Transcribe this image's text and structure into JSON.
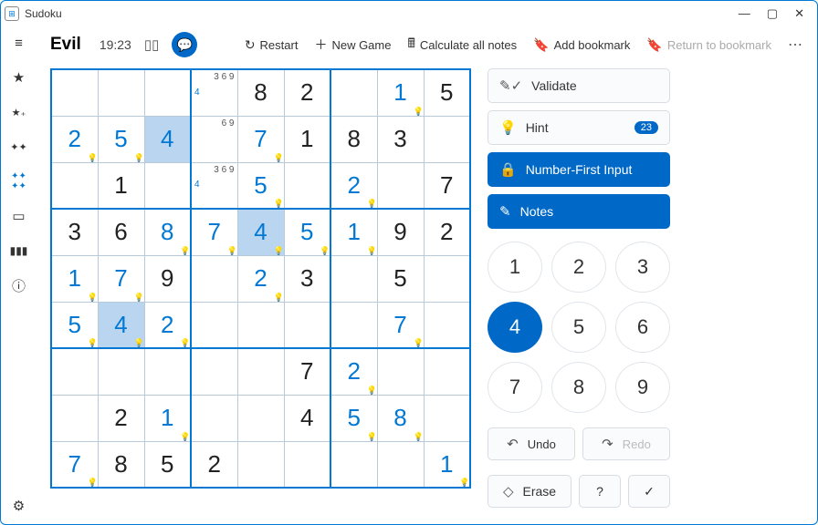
{
  "window": {
    "title": "Sudoku"
  },
  "topbar": {
    "difficulty": "Evil",
    "timer": "19:23",
    "restart": "Restart",
    "newgame": "New Game",
    "calc": "Calculate all notes",
    "addbm": "Add bookmark",
    "retbm": "Return to bookmark"
  },
  "panel": {
    "validate": "Validate",
    "hint": "Hint",
    "hint_badge": "23",
    "numfirst": "Number-First Input",
    "notes": "Notes",
    "undo": "Undo",
    "redo": "Redo",
    "erase": "Erase",
    "help": "?",
    "check": "✓"
  },
  "numpad": {
    "active": 4
  },
  "grid": [
    [
      {},
      {},
      {},
      {
        "pl": "4",
        "pr": "3\n6\n9"
      },
      {
        "v": "8",
        "t": "g"
      },
      {
        "v": "2",
        "t": "g"
      },
      {},
      {
        "v": "1",
        "t": "u",
        "h": 1
      },
      {
        "v": "5",
        "t": "g"
      }
    ],
    [
      {
        "v": "2",
        "t": "u",
        "h": 1
      },
      {
        "v": "5",
        "t": "u",
        "h": 1
      },
      {
        "v": "4",
        "t": "u",
        "sel": 1
      },
      {
        "pr": "6\n9"
      },
      {
        "v": "7",
        "t": "u",
        "h": 1
      },
      {
        "v": "1",
        "t": "g"
      },
      {
        "v": "8",
        "t": "g"
      },
      {
        "v": "3",
        "t": "g"
      },
      {}
    ],
    [
      {},
      {
        "v": "1",
        "t": "g"
      },
      {},
      {
        "pl": "4",
        "pr": "3\n6\n9"
      },
      {
        "v": "5",
        "t": "u",
        "h": 1
      },
      {},
      {
        "v": "2",
        "t": "u",
        "h": 1
      },
      {},
      {
        "v": "7",
        "t": "g"
      }
    ],
    [
      {
        "v": "3",
        "t": "g"
      },
      {
        "v": "6",
        "t": "g"
      },
      {
        "v": "8",
        "t": "u",
        "h": 1
      },
      {
        "v": "7",
        "t": "u",
        "h": 1
      },
      {
        "v": "4",
        "t": "u",
        "sel": 1,
        "h": 1
      },
      {
        "v": "5",
        "t": "u",
        "h": 1
      },
      {
        "v": "1",
        "t": "u",
        "h": 1
      },
      {
        "v": "9",
        "t": "g"
      },
      {
        "v": "2",
        "t": "g"
      }
    ],
    [
      {
        "v": "1",
        "t": "u",
        "h": 1
      },
      {
        "v": "7",
        "t": "u",
        "h": 1
      },
      {
        "v": "9",
        "t": "g"
      },
      {},
      {
        "v": "2",
        "t": "u",
        "h": 1
      },
      {
        "v": "3",
        "t": "g"
      },
      {},
      {
        "v": "5",
        "t": "g"
      },
      {}
    ],
    [
      {
        "v": "5",
        "t": "u",
        "h": 1
      },
      {
        "v": "4",
        "t": "u",
        "sel": 1,
        "h": 1
      },
      {
        "v": "2",
        "t": "u",
        "h": 1
      },
      {},
      {},
      {},
      {},
      {
        "v": "7",
        "t": "u",
        "h": 1
      },
      {}
    ],
    [
      {},
      {},
      {},
      {},
      {},
      {
        "v": "7",
        "t": "g"
      },
      {
        "v": "2",
        "t": "u",
        "h": 1
      },
      {},
      {}
    ],
    [
      {},
      {
        "v": "2",
        "t": "g"
      },
      {
        "v": "1",
        "t": "u",
        "h": 1
      },
      {},
      {},
      {
        "v": "4",
        "t": "g"
      },
      {
        "v": "5",
        "t": "u",
        "h": 1
      },
      {
        "v": "8",
        "t": "u",
        "h": 1
      },
      {}
    ],
    [
      {
        "v": "7",
        "t": "u",
        "h": 1
      },
      {
        "v": "8",
        "t": "g"
      },
      {
        "v": "5",
        "t": "g"
      },
      {
        "v": "2",
        "t": "g"
      },
      {},
      {},
      {},
      {},
      {
        "v": "1",
        "t": "u",
        "h": 1
      }
    ]
  ]
}
